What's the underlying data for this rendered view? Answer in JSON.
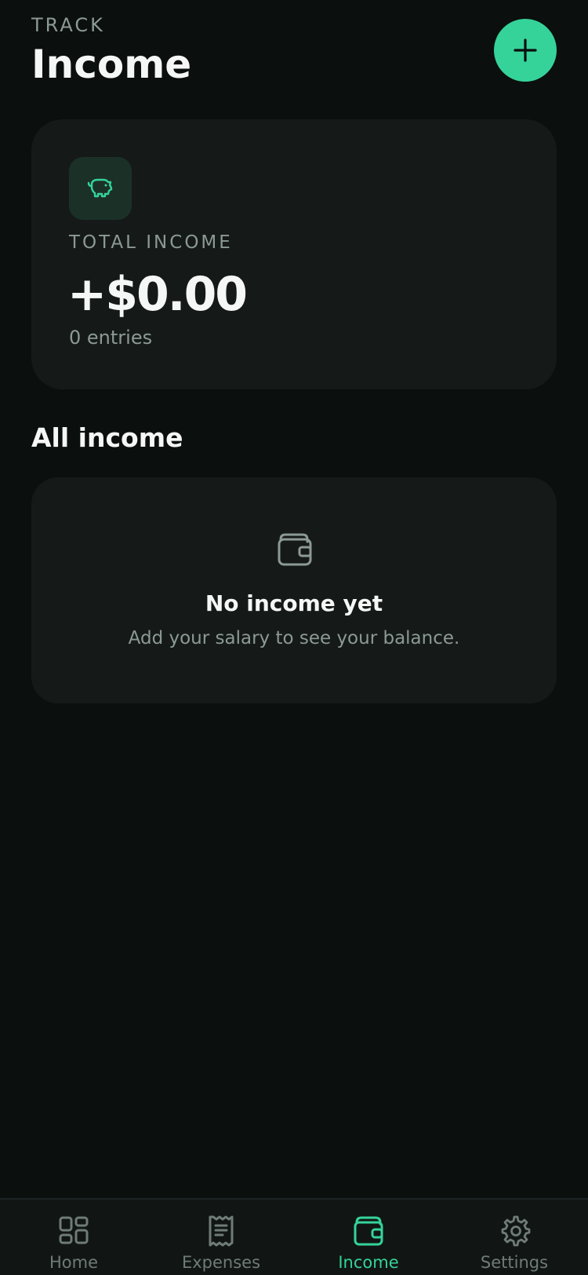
{
  "header": {
    "eyebrow": "TRACK",
    "title": "Income",
    "add_button_icon": "plus-icon"
  },
  "summary": {
    "icon": "piggy-bank-icon",
    "label": "TOTAL INCOME",
    "amount": "+$0.00",
    "entries": "0 entries"
  },
  "section": {
    "title": "All income"
  },
  "empty_state": {
    "icon": "wallet-icon",
    "title": "No income yet",
    "subtitle": "Add your salary to see your balance."
  },
  "nav": {
    "items": [
      {
        "label": "Home",
        "icon": "grid-icon",
        "active": false
      },
      {
        "label": "Expenses",
        "icon": "receipt-icon",
        "active": false
      },
      {
        "label": "Income",
        "icon": "wallet-icon",
        "active": true
      },
      {
        "label": "Settings",
        "icon": "gear-icon",
        "active": false
      }
    ]
  },
  "colors": {
    "background": "#0b0f0e",
    "card": "#151a19",
    "accent": "#35d39a",
    "muted_text": "#8c9994"
  }
}
